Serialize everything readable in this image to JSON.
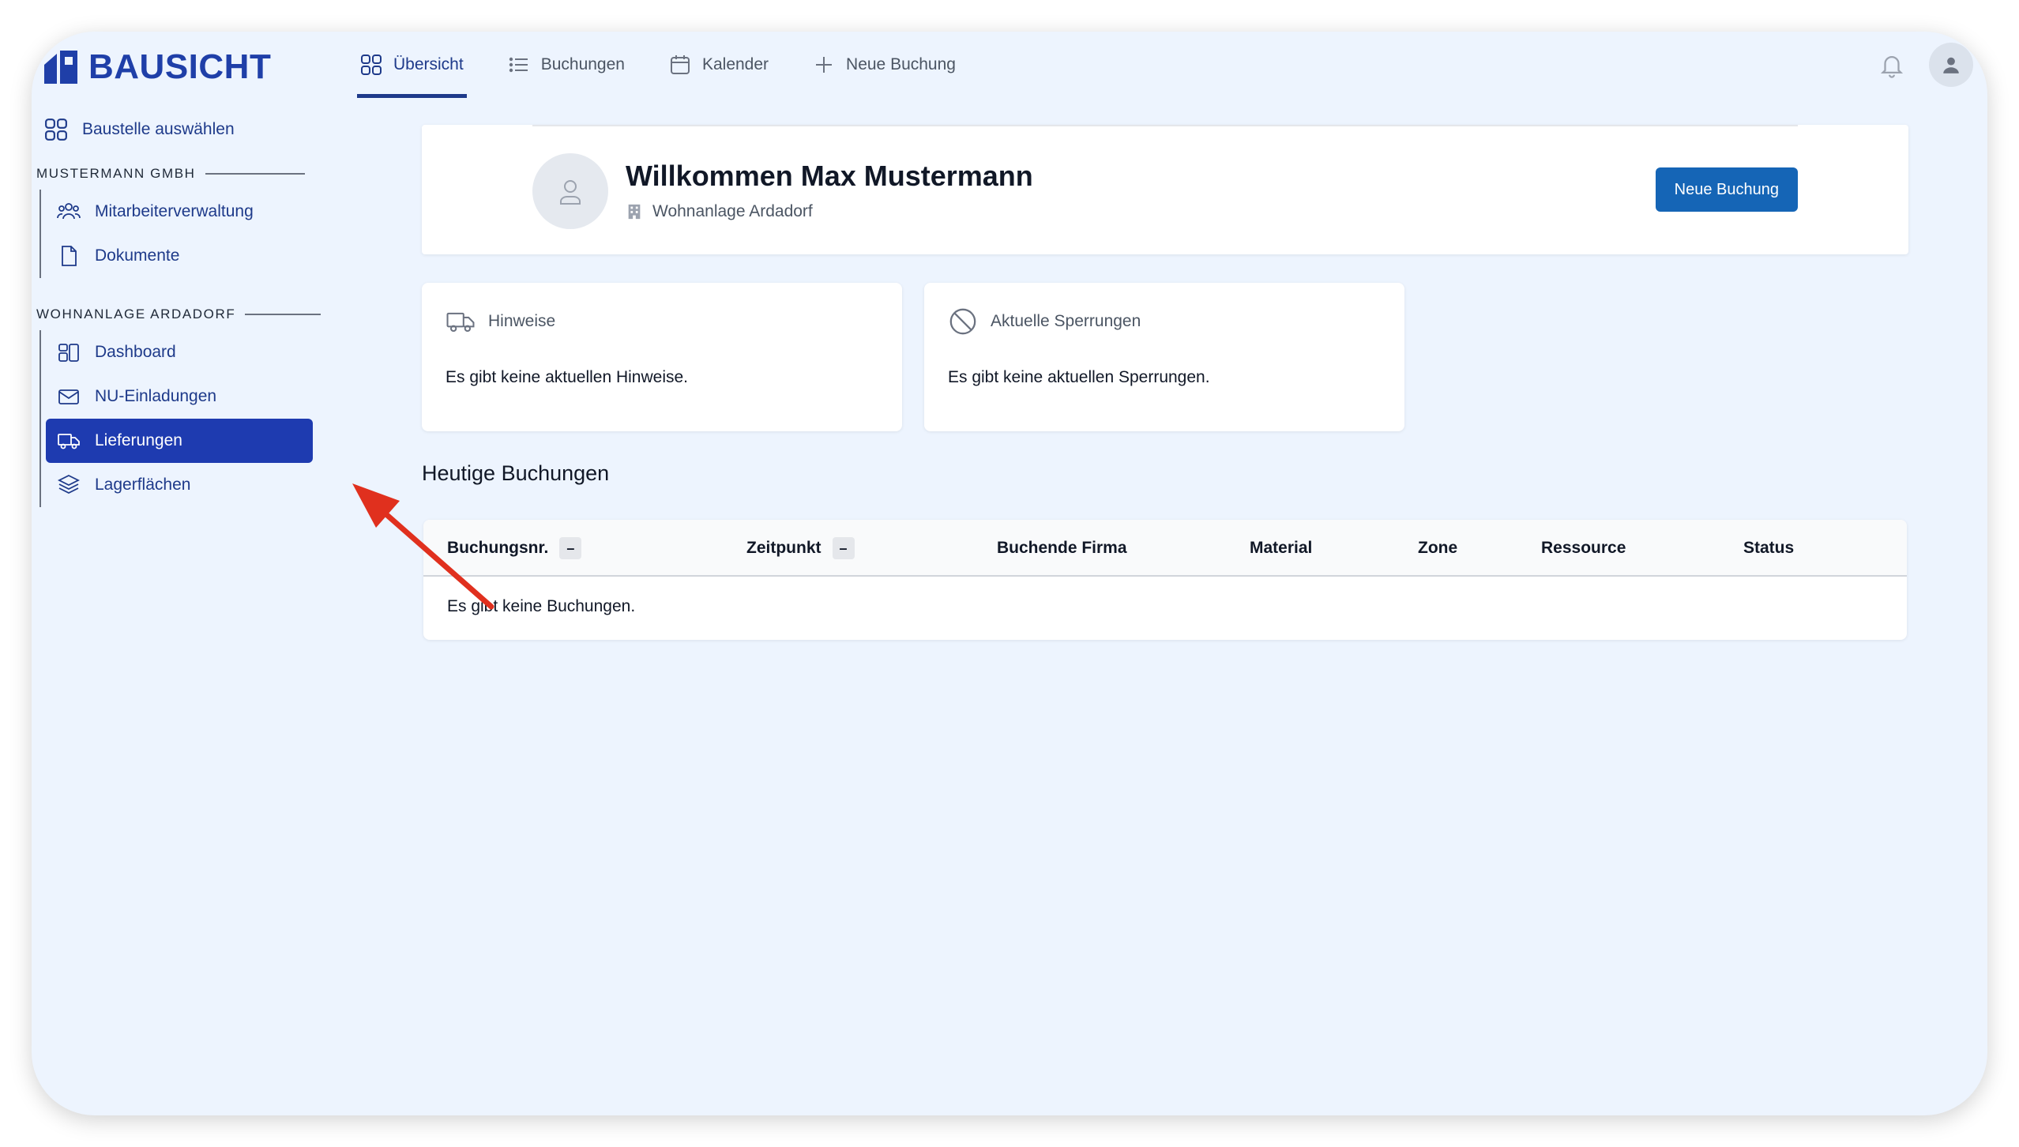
{
  "brand": {
    "name": "BAUSICHT"
  },
  "topnav": {
    "tabs": [
      {
        "label": "Übersicht",
        "icon": "grid-icon",
        "active": true
      },
      {
        "label": "Buchungen",
        "icon": "list-icon",
        "active": false
      },
      {
        "label": "Kalender",
        "icon": "calendar-icon",
        "active": false
      },
      {
        "label": "Neue Buchung",
        "icon": "plus-icon",
        "active": false
      }
    ]
  },
  "sidebar": {
    "select_site": "Baustelle auswählen",
    "company_section": "MUSTERMANN GMBH",
    "company_items": [
      {
        "label": "Mitarbeiterverwaltung",
        "icon": "users-icon"
      },
      {
        "label": "Dokumente",
        "icon": "document-icon"
      }
    ],
    "site_section": "WOHNANLAGE ARDADORF",
    "site_items": [
      {
        "label": "Dashboard",
        "icon": "dashboard-icon",
        "selected": false
      },
      {
        "label": "NU-Einladungen",
        "icon": "mail-icon",
        "selected": false
      },
      {
        "label": "Lieferungen",
        "icon": "truck-icon",
        "selected": true
      },
      {
        "label": "Lagerflächen",
        "icon": "layers-icon",
        "selected": false
      }
    ]
  },
  "welcome": {
    "title": "Willkommen Max Mustermann",
    "site": "Wohnanlage Ardadorf",
    "button": "Neue Buchung"
  },
  "cards": {
    "notices": {
      "title": "Hinweise",
      "body": "Es gibt keine aktuellen Hinweise."
    },
    "closures": {
      "title": "Aktuelle Sperrungen",
      "body": "Es gibt keine aktuellen Sperrungen."
    }
  },
  "bookings": {
    "title": "Heutige Buchungen",
    "columns": [
      "Buchungsnr.",
      "Zeitpunkt",
      "Buchende Firma",
      "Material",
      "Zone",
      "Ressource",
      "Status"
    ],
    "sort_symbol": "–",
    "empty": "Es gibt keine Buchungen."
  },
  "colors": {
    "brand": "#1f3fa8",
    "accent": "#1e3a8a",
    "selected_bg": "#1e3bb0",
    "button": "#1565b6",
    "annotation_arrow": "#e0301e",
    "background": "#edf4fe"
  }
}
